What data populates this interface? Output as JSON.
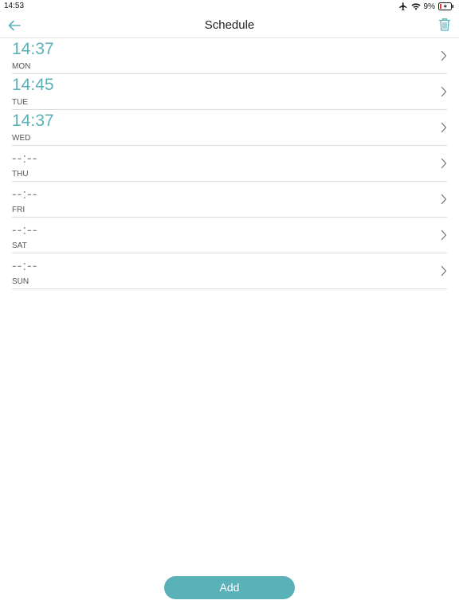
{
  "status_bar": {
    "time": "14:53",
    "battery_percent": "9%",
    "icons": [
      "airplane-icon",
      "wifi-icon",
      "battery-charging-icon"
    ]
  },
  "header": {
    "title": "Schedule",
    "back_icon": "back-arrow-icon",
    "delete_icon": "trash-icon"
  },
  "schedule": {
    "rows": [
      {
        "time": "14:37",
        "day": "MON",
        "set": true
      },
      {
        "time": "14:45",
        "day": "TUE",
        "set": true
      },
      {
        "time": "14:37",
        "day": "WED",
        "set": true
      },
      {
        "time": "--:--",
        "day": "THU",
        "set": false
      },
      {
        "time": "--:--",
        "day": "FRI",
        "set": false
      },
      {
        "time": "--:--",
        "day": "SAT",
        "set": false
      },
      {
        "time": "--:--",
        "day": "SUN",
        "set": false
      }
    ]
  },
  "footer": {
    "add_label": "Add"
  },
  "colors": {
    "accent": "#5ab1b7",
    "unset_time": "#888888",
    "divider": "#dcdcdc"
  }
}
